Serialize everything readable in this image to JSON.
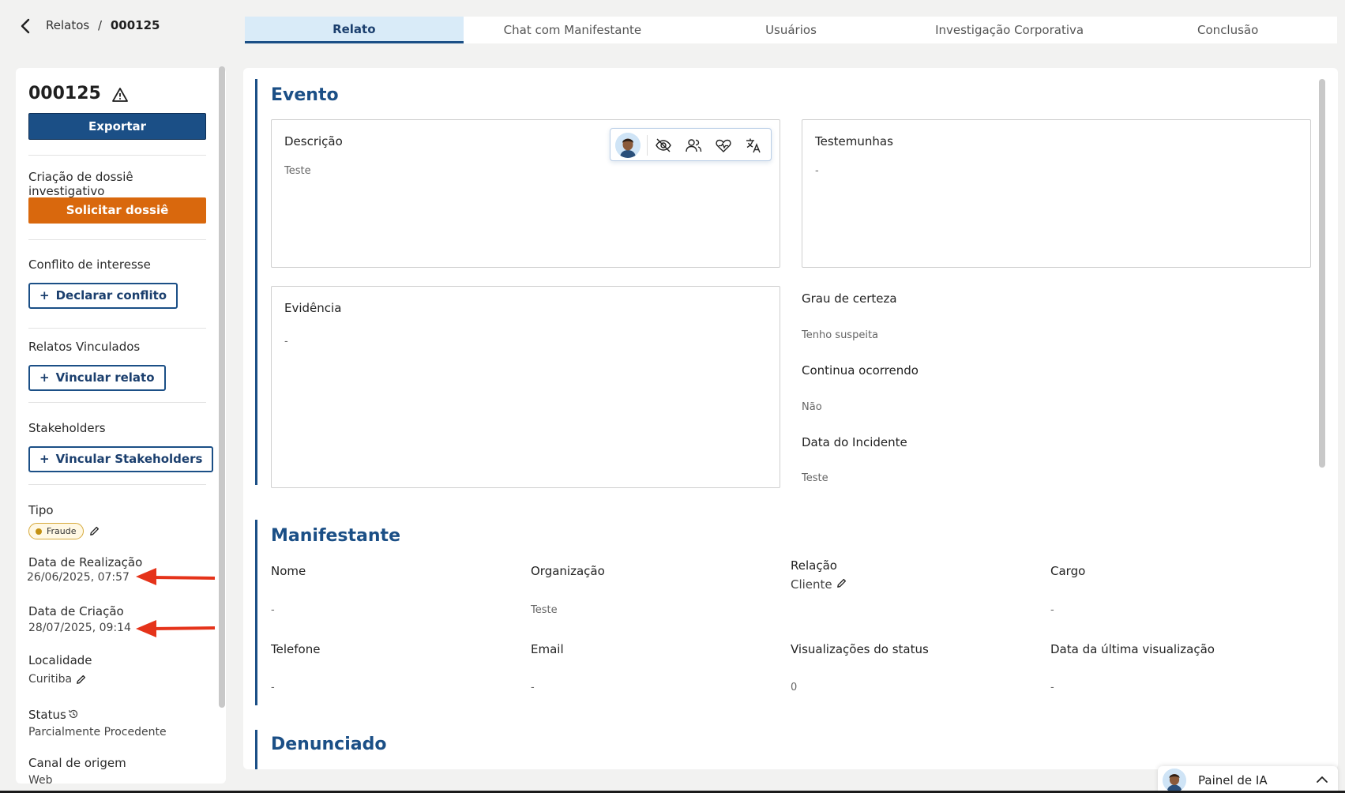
{
  "breadcrumb": {
    "parent": "Relatos",
    "separator": "/",
    "current": "000125"
  },
  "tabs": [
    "Relato",
    "Chat com Manifestante",
    "Usuários",
    "Investigação Corporativa",
    "Conclusão"
  ],
  "sidebar": {
    "report_id": "000125",
    "export_label": "Exportar",
    "dossie_section": "Criação de dossiê investigativo",
    "dossie_button": "Solicitar dossiê",
    "conflict_section": "Conflito de interesse",
    "conflict_button": "Declarar conflito",
    "linked_section": "Relatos Vinculados",
    "linked_button": "Vincular relato",
    "stakeholders_section": "Stakeholders",
    "stakeholders_button": "Vincular Stakeholders",
    "plus": "+",
    "tipo_label": "Tipo",
    "tipo_value": "Fraude",
    "realizacao_label": "Data de Realização",
    "realizacao_value": "26/06/2025, 07:57",
    "criacao_label": "Data de Criação",
    "criacao_value": "28/07/2025, 09:14",
    "localidade_label": "Localidade",
    "localidade_value": "Curitiba",
    "status_label": "Status",
    "status_value": "Parcialmente Procedente",
    "canal_label": "Canal de origem",
    "canal_value": "Web"
  },
  "evento": {
    "title": "Evento",
    "descricao_label": "Descrição",
    "descricao_value": "Teste",
    "testemunhas_label": "Testemunhas",
    "testemunhas_value": "-",
    "evidencia_label": "Evidência",
    "evidencia_value": "-",
    "certeza_label": "Grau de certeza",
    "certeza_value": "Tenho suspeita",
    "continua_label": "Continua ocorrendo",
    "continua_value": "Não",
    "data_label": "Data do Incidente",
    "data_value": "Teste"
  },
  "manifestante": {
    "title": "Manifestante",
    "nome_label": "Nome",
    "nome_value": "-",
    "org_label": "Organização",
    "org_value": "Teste",
    "relacao_label": "Relação",
    "relacao_value": "Cliente",
    "cargo_label": "Cargo",
    "cargo_value": "-",
    "telefone_label": "Telefone",
    "telefone_value": "-",
    "email_label": "Email",
    "email_value": "-",
    "views_label": "Visualizações do status",
    "views_value": "0",
    "last_view_label": "Data da última visualização",
    "last_view_value": "-"
  },
  "denunciado": {
    "title": "Denunciado"
  },
  "ai_panel": {
    "label": "Painel de IA"
  },
  "colors": {
    "primary": "#1b4f86",
    "orange": "#d9680d",
    "annotation_red": "#e5331a",
    "badge": "#c49112"
  },
  "icons": [
    "back-arrow-icon",
    "warning-icon",
    "pencil-icon",
    "history-icon",
    "eye-off-icon",
    "users-icon",
    "heart-pulse-icon",
    "translate-icon",
    "chevron-up-icon"
  ]
}
